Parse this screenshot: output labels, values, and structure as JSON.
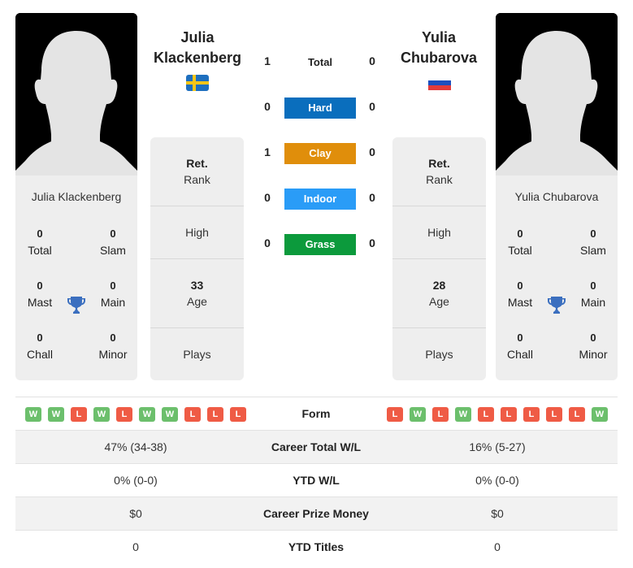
{
  "players": [
    {
      "first_name": "Julia",
      "last_name": "Klackenberg",
      "full_name": "Julia Klackenberg",
      "flag_icon": "sweden-flag-icon",
      "titles": {
        "total": {
          "value": "0",
          "label": "Total"
        },
        "slam": {
          "value": "0",
          "label": "Slam"
        },
        "mast": {
          "value": "0",
          "label": "Mast"
        },
        "main": {
          "value": "0",
          "label": "Main"
        },
        "chall": {
          "value": "0",
          "label": "Chall"
        },
        "minor": {
          "value": "0",
          "label": "Minor"
        }
      },
      "info": {
        "rank": {
          "value": "Ret.",
          "label": "Rank"
        },
        "high": {
          "value": "",
          "label": "High"
        },
        "age": {
          "value": "33",
          "label": "Age"
        },
        "plays": {
          "value": "",
          "label": "Plays"
        }
      },
      "form": [
        "W",
        "W",
        "L",
        "W",
        "L",
        "W",
        "W",
        "L",
        "L",
        "L"
      ]
    },
    {
      "first_name": "Yulia",
      "last_name": "Chubarova",
      "full_name": "Yulia Chubarova",
      "flag_icon": "russia-flag-icon",
      "titles": {
        "total": {
          "value": "0",
          "label": "Total"
        },
        "slam": {
          "value": "0",
          "label": "Slam"
        },
        "mast": {
          "value": "0",
          "label": "Mast"
        },
        "main": {
          "value": "0",
          "label": "Main"
        },
        "chall": {
          "value": "0",
          "label": "Chall"
        },
        "minor": {
          "value": "0",
          "label": "Minor"
        }
      },
      "info": {
        "rank": {
          "value": "Ret.",
          "label": "Rank"
        },
        "high": {
          "value": "",
          "label": "High"
        },
        "age": {
          "value": "28",
          "label": "Age"
        },
        "plays": {
          "value": "",
          "label": "Plays"
        }
      },
      "form": [
        "L",
        "W",
        "L",
        "W",
        "L",
        "L",
        "L",
        "L",
        "L",
        "W"
      ]
    }
  ],
  "h2h": {
    "total": {
      "label": "Total",
      "p1": "1",
      "p2": "0"
    },
    "surfaces": [
      {
        "label": "Hard",
        "p1": "0",
        "p2": "0",
        "color": "#0a6ebd"
      },
      {
        "label": "Clay",
        "p1": "1",
        "p2": "0",
        "color": "#e08e0b"
      },
      {
        "label": "Indoor",
        "p1": "0",
        "p2": "0",
        "color": "#2a9cf7"
      },
      {
        "label": "Grass",
        "p1": "0",
        "p2": "0",
        "color": "#0c9a3c"
      }
    ]
  },
  "comparison": {
    "form_label": "Form",
    "rows": [
      {
        "label": "Career Total W/L",
        "p1": "47% (34-38)",
        "p2": "16% (5-27)"
      },
      {
        "label": "YTD W/L",
        "p1": "0% (0-0)",
        "p2": "0% (0-0)"
      },
      {
        "label": "Career Prize Money",
        "p1": "$0",
        "p2": "$0"
      },
      {
        "label": "YTD Titles",
        "p1": "0",
        "p2": "0"
      }
    ]
  },
  "colors": {
    "win": "#6cbf6c",
    "loss": "#ef5b45",
    "trophy": "#3b6fbf"
  }
}
